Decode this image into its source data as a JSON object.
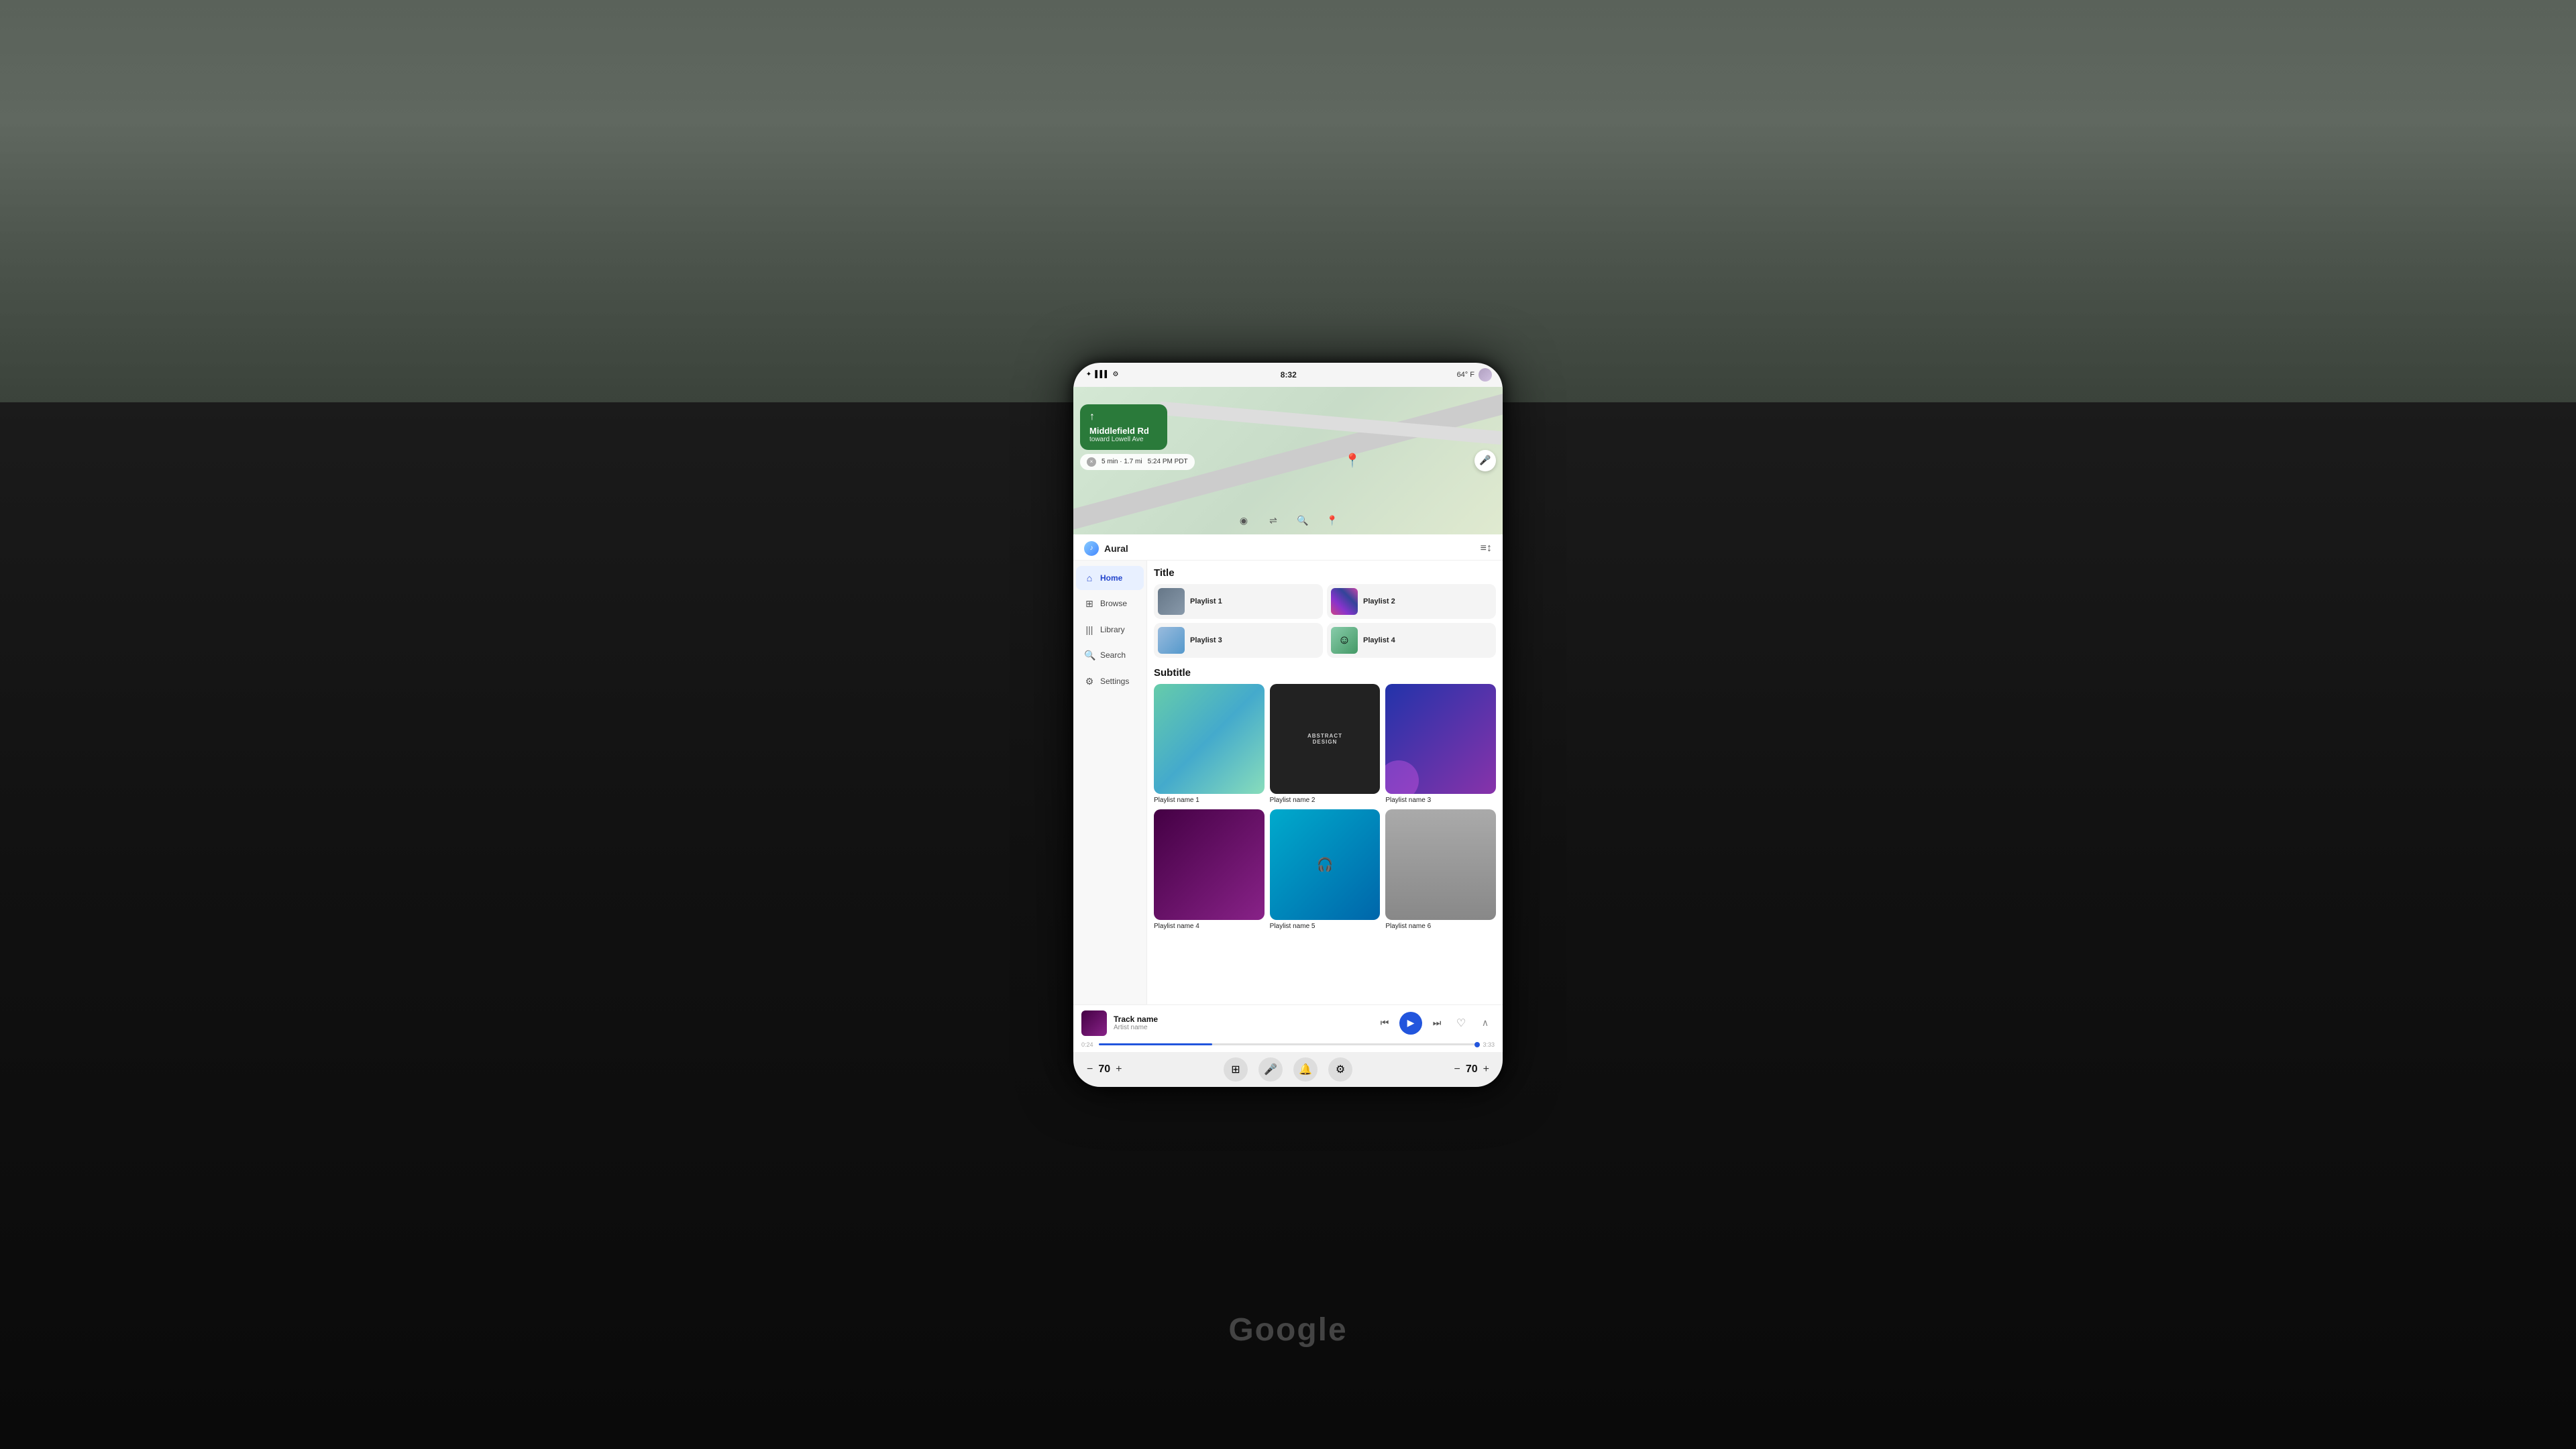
{
  "status_bar": {
    "time": "8:32",
    "temperature": "64° F",
    "signal_icon": "●●●",
    "bluetooth_icon": "⬡",
    "settings_icon": "⚙"
  },
  "navigation": {
    "street": "Middlefield Rd",
    "toward": "toward Lowell Ave",
    "eta_time": "5 min · 1.7 mi",
    "eta_arrival": "5:24 PM PDT",
    "arrow_up": "↑",
    "dismiss_label": "×"
  },
  "map_controls": {
    "layers_icon": "◉",
    "route_icon": "⇄",
    "search_icon": "🔍",
    "pin_icon": "📍"
  },
  "app": {
    "logo_text": "Aural",
    "queue_icon": "≡",
    "nav_items": [
      {
        "id": "home",
        "label": "Home",
        "icon": "⌂",
        "active": true
      },
      {
        "id": "browse",
        "label": "Browse",
        "icon": "⊞",
        "active": false
      },
      {
        "id": "library",
        "label": "Library",
        "icon": "|||",
        "active": false
      },
      {
        "id": "search",
        "label": "Search",
        "icon": "🔍",
        "active": false
      },
      {
        "id": "settings",
        "label": "Settings",
        "icon": "⚙",
        "active": false
      }
    ],
    "title_section": {
      "heading": "Title",
      "playlists": [
        {
          "id": "p1",
          "name": "Playlist 1",
          "thumb_type": "gradient1"
        },
        {
          "id": "p2",
          "name": "Playlist 2",
          "thumb_type": "gradient2"
        },
        {
          "id": "p3",
          "name": "Playlist 3",
          "thumb_type": "gradient3"
        },
        {
          "id": "p4",
          "name": "Playlist 4",
          "thumb_type": "gradient4"
        }
      ]
    },
    "subtitle_section": {
      "heading": "Subtitle",
      "playlists": [
        {
          "id": "pn1",
          "name": "Playlist name 1",
          "thumb_type": "abstract1"
        },
        {
          "id": "pn2",
          "name": "Playlist name 2",
          "thumb_type": "abstract2"
        },
        {
          "id": "pn3",
          "name": "Playlist name 3",
          "thumb_type": "abstract3"
        },
        {
          "id": "pn4",
          "name": "Playlist name 4",
          "thumb_type": "thumb4a"
        },
        {
          "id": "pn5",
          "name": "Playlist name 5",
          "thumb_type": "thumb4b"
        },
        {
          "id": "pn6",
          "name": "Playlist name 6",
          "thumb_type": "thumb4c"
        }
      ]
    }
  },
  "now_playing": {
    "track_name": "Track name",
    "artist_name": "Artist name",
    "progress_time": "0:24",
    "total_time": "3:33",
    "skip_back_icon": "⏮",
    "play_icon": "▶",
    "skip_fwd_icon": "⏭",
    "heart_icon": "♡",
    "expand_icon": "⌃"
  },
  "bottom_bar": {
    "volume_left": {
      "minus": "−",
      "value": "70",
      "plus": "+"
    },
    "volume_right": {
      "minus": "−",
      "value": "70",
      "plus": "+"
    },
    "icons": [
      {
        "id": "grid",
        "symbol": "⊞",
        "active": false
      },
      {
        "id": "mic",
        "symbol": "🎤",
        "active": false
      },
      {
        "id": "bell",
        "symbol": "🔔",
        "active": false
      },
      {
        "id": "settings",
        "symbol": "⚙",
        "active": false
      }
    ]
  },
  "google_logo": "Google"
}
